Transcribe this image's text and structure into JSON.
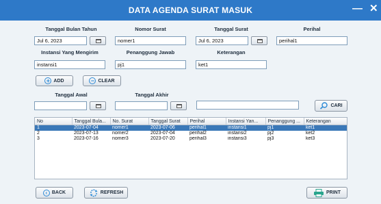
{
  "window": {
    "title": "DATA AGENDA SURAT MASUK",
    "minimize_glyph": "—",
    "close_glyph": "✕"
  },
  "form": {
    "tanggal_bulan_tahun": {
      "label": "Tanggal Bulan Tahun",
      "value": "Jul 6, 2023"
    },
    "nomor_surat": {
      "label": "Nomor Surat",
      "value": "nomer1"
    },
    "tanggal_surat": {
      "label": "Tanggal Surat",
      "value": "Jul 6, 2023"
    },
    "perihal": {
      "label": "Perihal",
      "value": "perihal1"
    },
    "instansi": {
      "label": "Instansi Yang Mengirim",
      "value": "instansi1"
    },
    "penanggung_jawab": {
      "label": "Penanggung Jawab",
      "value": "pj1"
    },
    "keterangan": {
      "label": "Keterangan",
      "value": "ket1"
    }
  },
  "buttons": {
    "add": "ADD",
    "clear": "CLEAR",
    "cari": "CARI",
    "back": "BACK",
    "refresh": "REFRESH",
    "print": "PRINT"
  },
  "search": {
    "tanggal_awal_label": "Tanggal Awal",
    "tanggal_akhir_label": "Tanggal Akhir",
    "tanggal_awal_value": "",
    "tanggal_akhir_value": "",
    "keyword_value": ""
  },
  "table": {
    "columns": [
      "No",
      "Tanggal Bula...",
      "No. Surat",
      "Tanggal Surat",
      "Perihal",
      "Instansi Yan...",
      "Penanggung ...",
      "Keterangan"
    ],
    "rows": [
      [
        "1",
        "2023-07-04",
        "nomer1",
        "2023-07-06",
        "perihal1",
        "instansi1",
        "pj1",
        "ket1"
      ],
      [
        "2",
        "2023-07-13",
        "nomer2",
        "2023-07-04",
        "perihal2",
        "instansi2",
        "pj2",
        "ket2"
      ],
      [
        "3",
        "2023-07-16",
        "nomer3",
        "2023-07-20",
        "perihal3",
        "instansi3",
        "pj3",
        "ket3"
      ]
    ],
    "selected_row": 0
  },
  "colors": {
    "titlebar": "#2e79c8",
    "selection": "#3a78b8",
    "icon_blue": "#2c8ad6",
    "print_green": "#2aa58e"
  },
  "icons": {
    "calendar": "calendar-icon",
    "add": "plus-circle-icon",
    "clear": "minus-circle-icon",
    "cari": "magnifier-icon",
    "back": "arrow-left-icon",
    "refresh": "refresh-icon",
    "print": "printer-icon"
  }
}
